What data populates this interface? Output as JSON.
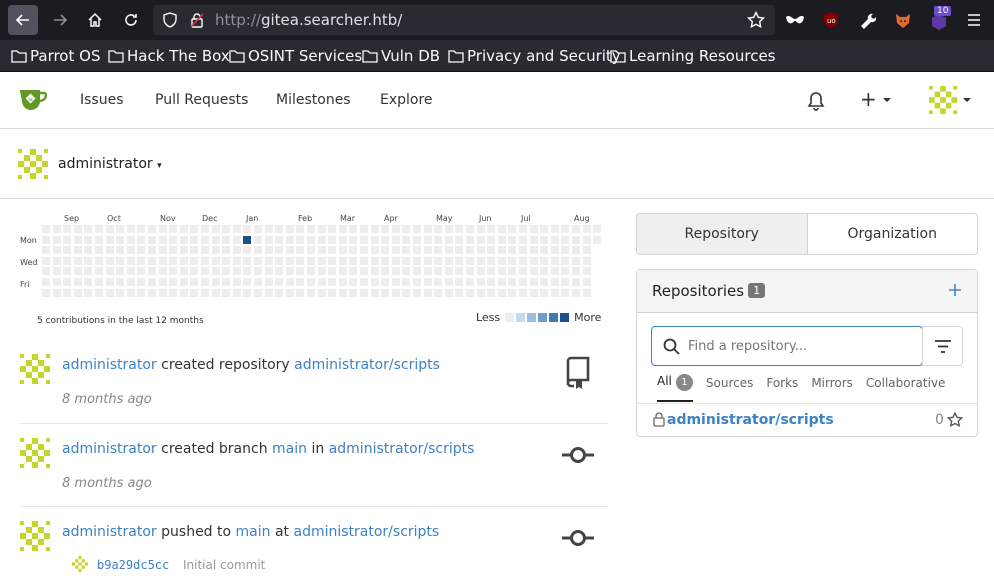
{
  "browser": {
    "url_protocol": "http://",
    "url_host": "gitea.searcher.htb/",
    "extension_badge": "10",
    "bookmarks": [
      "Parrot OS",
      "Hack The Box",
      "OSINT Services",
      "Vuln DB",
      "Privacy and Security",
      "Learning Resources"
    ]
  },
  "nav": {
    "issues": "Issues",
    "pull_requests": "Pull Requests",
    "milestones": "Milestones",
    "explore": "Explore",
    "plus": "+"
  },
  "context": {
    "user": "administrator"
  },
  "heatmap": {
    "months": [
      "Sep",
      "Oct",
      "Nov",
      "Dec",
      "Jan",
      "Feb",
      "Mar",
      "Apr",
      "May",
      "Jun",
      "Jul",
      "Aug"
    ],
    "days": [
      "Mon",
      "Wed",
      "Fri"
    ],
    "summary": "5 contributions in the last 12 months",
    "less": "Less",
    "more": "More",
    "active_week": 19,
    "active_day": 1,
    "colors": [
      "#ededed",
      "#c6d8ec",
      "#9dbde0",
      "#6e9ccf",
      "#4477b5",
      "#1f4e8c"
    ]
  },
  "feed": [
    {
      "actor": "administrator",
      "verb": "created repository",
      "target": "administrator/scripts",
      "ago": "8 months ago",
      "icon": "repo-icon"
    },
    {
      "actor": "administrator",
      "verb": "created branch",
      "branch": "main",
      "prep": "in",
      "target": "administrator/scripts",
      "ago": "8 months ago",
      "icon": "commit-icon"
    },
    {
      "actor": "administrator",
      "verb": "pushed to",
      "branch": "main",
      "prep": "at",
      "target": "administrator/scripts",
      "sha": "b9a29dc5cc",
      "message": "Initial commit",
      "icon": "commit-icon"
    }
  ],
  "dashboard": {
    "tab_repository": "Repository",
    "tab_organization": "Organization",
    "repos_title": "Repositories",
    "repos_count": "1",
    "search_placeholder": "Find a repository...",
    "subtabs": {
      "all": "All",
      "all_count": "1",
      "sources": "Sources",
      "forks": "Forks",
      "mirrors": "Mirrors",
      "collaborative": "Collaborative"
    },
    "repo": {
      "name": "administrator/scripts",
      "stars": "0"
    }
  }
}
